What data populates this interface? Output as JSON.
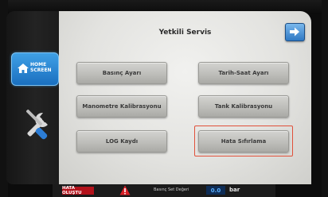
{
  "screen": {
    "title": "Yetkili Servis"
  },
  "sidebar": {
    "home_label": "HOME SCREEN",
    "home_icon": "house-icon",
    "tools_icon": "wrench-screwdriver-icon"
  },
  "navigation": {
    "next_icon": "arrow-right-icon"
  },
  "menu": {
    "basinc_ayari": "Basınç Ayarı",
    "tarih_saat_ayari": "Tarih-Saat Ayarı",
    "manometre_kalibrasyonu": "Manometre Kalibrasyonu",
    "tank_kalibrasyonu": "Tank Kalibrasyonu",
    "log_kaydi": "LOG Kaydı",
    "hata_sifirlama": "Hata Sıfırlama"
  },
  "status": {
    "error_text": "HATA OLUŞTU",
    "warning_icon": "warning-triangle-icon",
    "pressure_label": "Basınç Set Değeri",
    "pressure_value": "0.0",
    "pressure_unit": "bar"
  },
  "colors": {
    "highlight": "#e0503a",
    "error_bg": "#b3121b",
    "accent_blue": "#2f78c4"
  }
}
